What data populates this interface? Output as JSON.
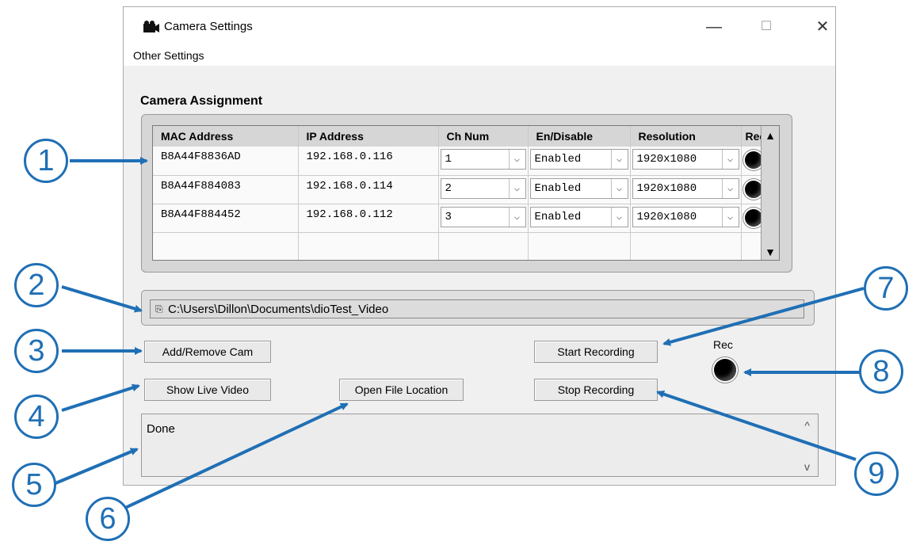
{
  "window": {
    "title": "Camera Settings",
    "controls": {
      "minimize": "—",
      "maximize": "☐",
      "close": "✕"
    }
  },
  "menu": {
    "items": [
      {
        "label": "Other Settings"
      }
    ]
  },
  "camera_assignment": {
    "label": "Camera Assignment",
    "columns": [
      "MAC Address",
      "IP Address",
      "Ch Num",
      "En/Disable",
      "Resolution",
      "Rec"
    ],
    "rows": [
      {
        "mac": "B8A44F8836AD",
        "ip": "192.168.0.116",
        "ch": "1",
        "enable": "Enabled",
        "resolution": "1920x1080"
      },
      {
        "mac": "B8A44F884083",
        "ip": "192.168.0.114",
        "ch": "2",
        "enable": "Enabled",
        "resolution": "1920x1080"
      },
      {
        "mac": "B8A44F884452",
        "ip": "192.168.0.112",
        "ch": "3",
        "enable": "Enabled",
        "resolution": "1920x1080"
      }
    ]
  },
  "save_path": {
    "icon": "folder-path-icon",
    "value": "C:\\Users\\Dillon\\Documents\\dioTest_Video"
  },
  "buttons": {
    "add_remove": "Add/Remove Cam",
    "show_live": "Show Live Video",
    "open_file": "Open File Location",
    "start_rec": "Start Recording",
    "stop_rec": "Stop Recording"
  },
  "rec_indicator": {
    "label": "Rec"
  },
  "status": {
    "text": "Done"
  },
  "callouts": [
    "1",
    "2",
    "3",
    "4",
    "5",
    "6",
    "7",
    "8",
    "9"
  ],
  "colors": {
    "callout": "#1f6fb5",
    "window_bg": "#f0f0f0"
  }
}
